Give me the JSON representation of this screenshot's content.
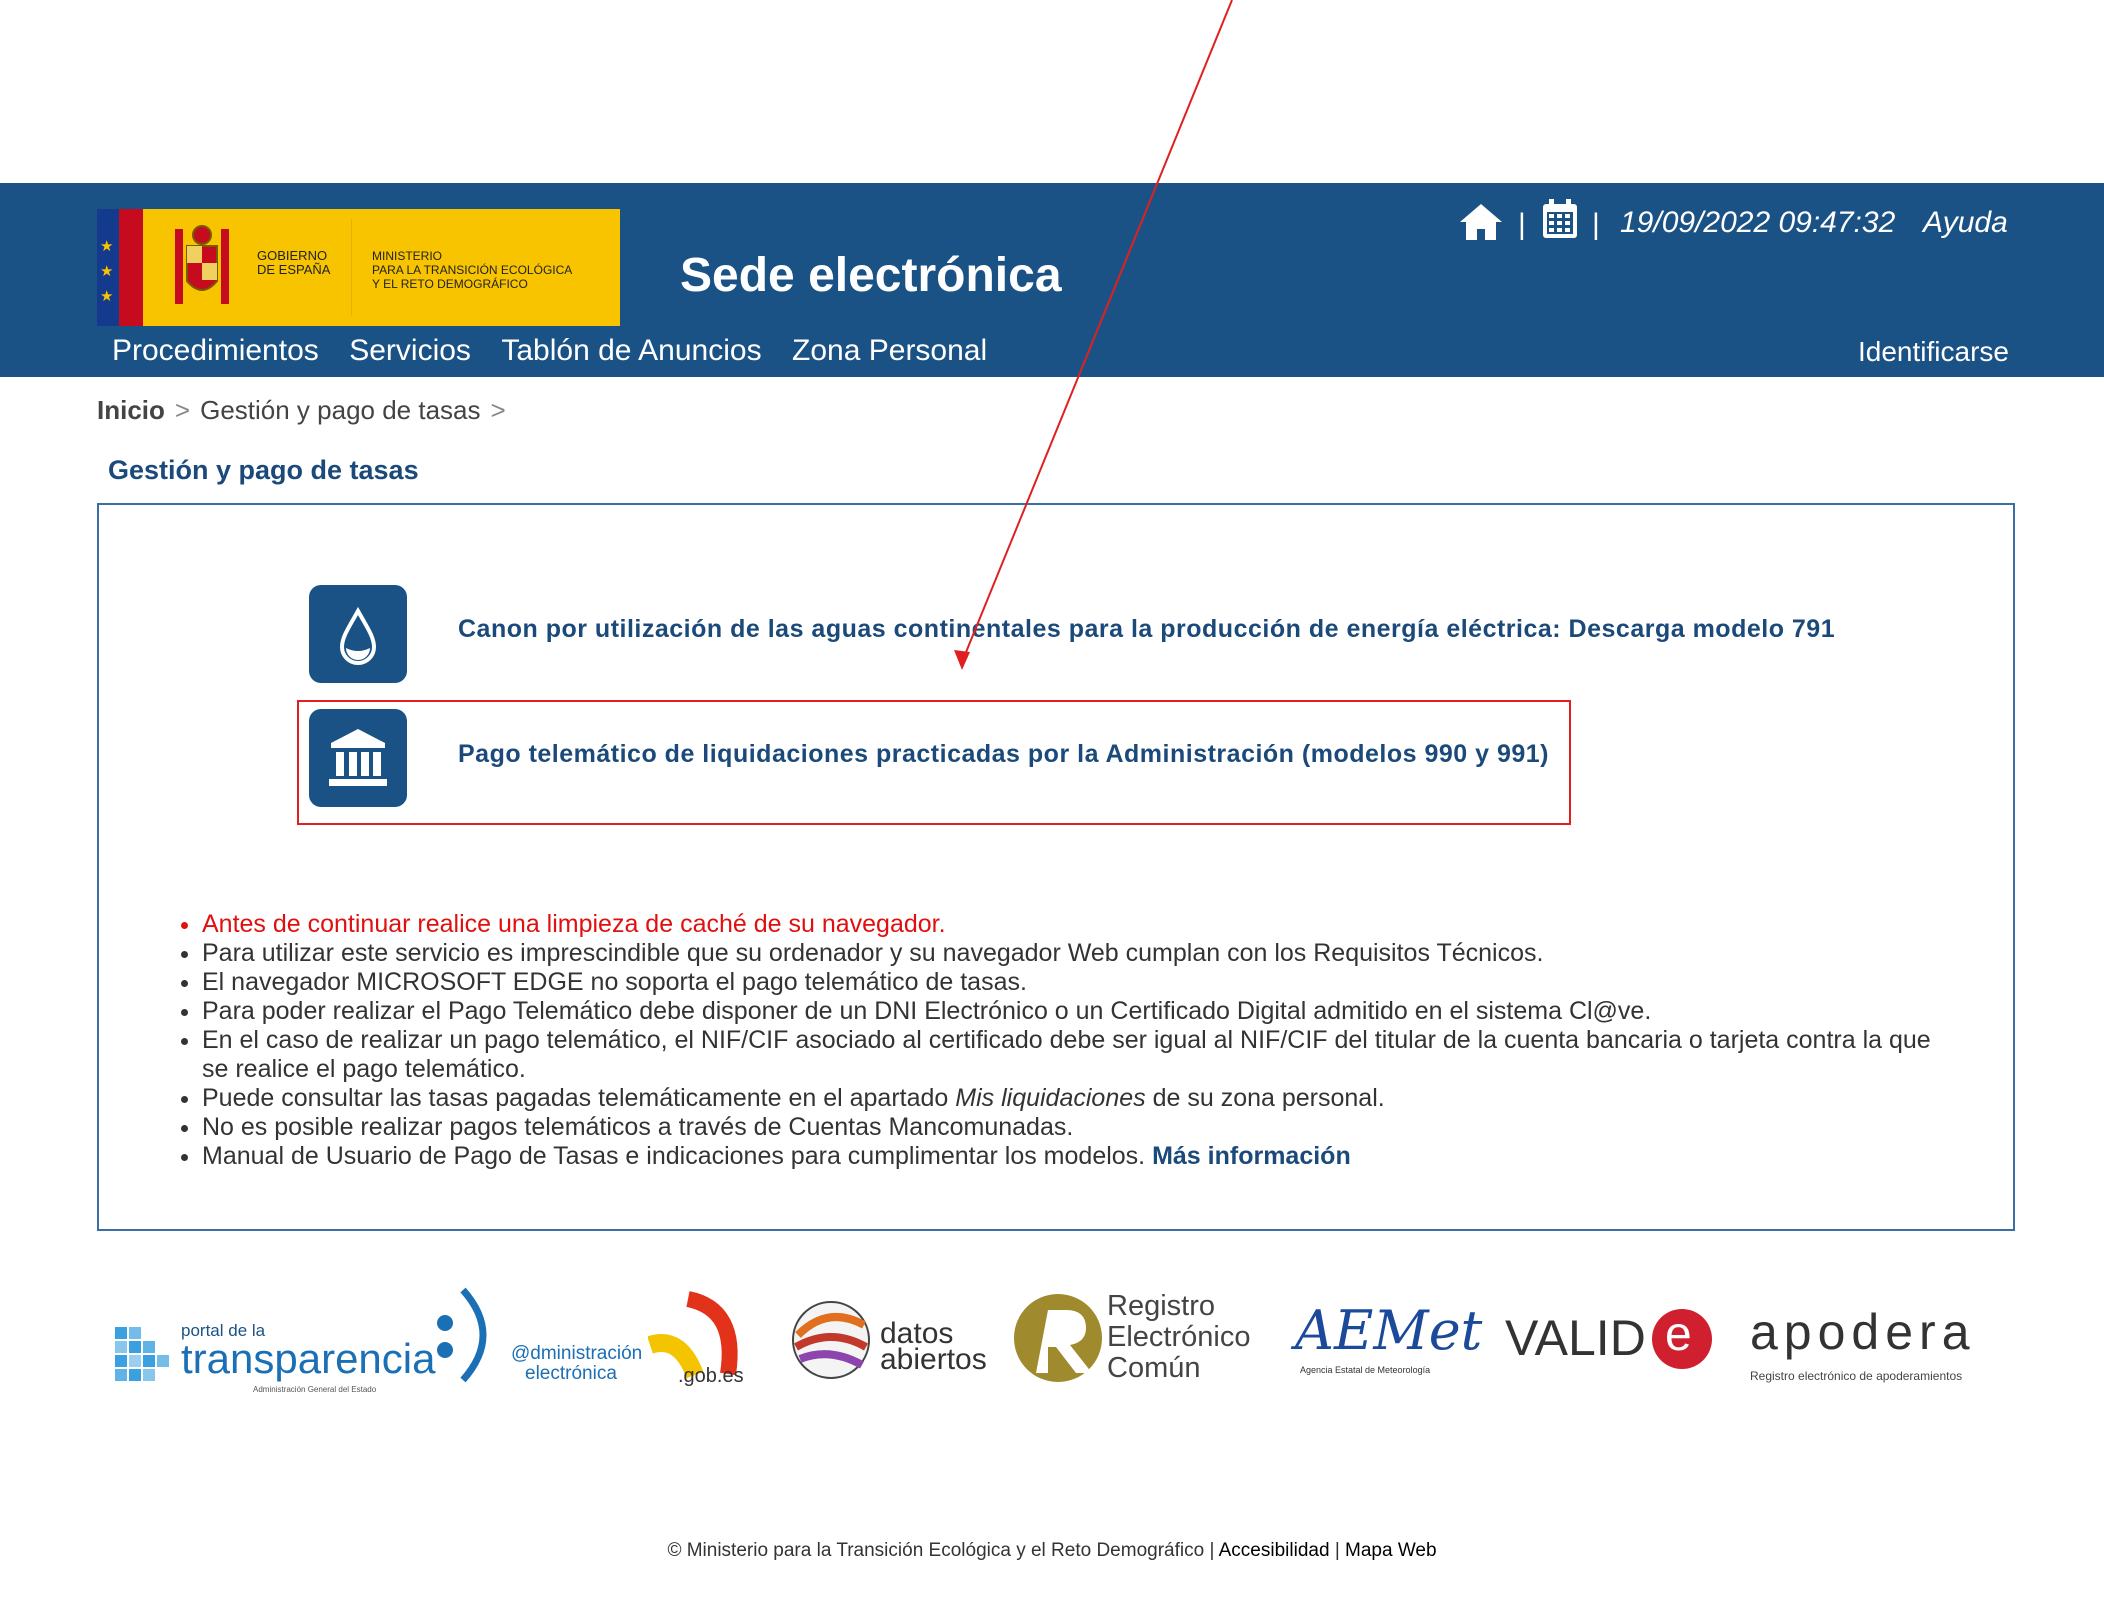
{
  "header": {
    "gov_label_1": "GOBIERNO",
    "gov_label_2": "DE ESPAÑA",
    "ministry_1": "MINISTERIO",
    "ministry_2": "PARA LA TRANSICIÓN ECOLÓGICA",
    "ministry_3": "Y EL RETO DEMOGRÁFICO",
    "site_title": "Sede electrónica",
    "separator": "|",
    "datetime": "19/09/2022 09:47:32",
    "help": "Ayuda",
    "login": "Identificarse"
  },
  "nav": {
    "items": [
      "Procedimientos",
      "Servicios",
      "Tablón de Anuncios",
      "Zona Personal"
    ]
  },
  "breadcrumb": {
    "home": "Inicio",
    "current": "Gestión y pago de tasas",
    "sep": ">"
  },
  "page_title": "Gestión y pago de tasas",
  "services": [
    {
      "label": "Canon por utilización de las aguas continentales para la producción de energía eléctrica: Descarga modelo 791",
      "icon": "water-drop-icon"
    },
    {
      "label": "Pago telemático de liquidaciones practicadas por la Administración (modelos 990 y 991)",
      "icon": "bank-building-icon"
    }
  ],
  "notes": {
    "n1": "Antes de continuar realice una limpieza de caché de su navegador.",
    "n2": "Para utilizar este servicio es imprescindible que su ordenador y su navegador Web cumplan con los Requisitos Técnicos.",
    "n3": "El navegador MICROSOFT EDGE no soporta el pago telemático de tasas.",
    "n4": "Para poder realizar el Pago Telemático debe disponer de un DNI Electrónico o un Certificado Digital admitido en el sistema Cl@ve.",
    "n5": "En el caso de realizar un pago telemático, el NIF/CIF asociado al certificado debe ser igual al NIF/CIF del titular de la cuenta bancaria o tarjeta contra la que se realice el pago telemático.",
    "n6_pre": "Puede consultar las tasas pagadas telemáticamente en el apartado ",
    "n6_em": "Mis liquidaciones",
    "n6_post": " de su zona personal.",
    "n7": "No es posible realizar pagos telemáticos a través de Cuentas Mancomunadas.",
    "n8": "Manual de Usuario de Pago de Tasas e indicaciones para cumplimentar los modelos. ",
    "n8_link": "Más información"
  },
  "partners": {
    "transparencia_small": "portal de la",
    "transparencia": "transparencia",
    "transparencia_sub": "Administración General del Estado",
    "admin_e": "@dministración",
    "admin_e2": "electrónica",
    "gob": ".gob.es",
    "datos_1": "datos",
    "datos_2": "abiertos",
    "rec_1": "Registro",
    "rec_2": "Electrónico",
    "rec_3": "Común",
    "aemet": "AEMet",
    "aemet_sub": "Agencia Estatal de Meteorología",
    "valide": "VALID",
    "valide_e": "e",
    "apodera": "apodera",
    "apodera_sub": "Registro electrónico de apoderamientos"
  },
  "footer": {
    "copyright": "© Ministerio para la Transición Ecológica y el Reto Demográfico",
    "accesibilidad": "Accesibilidad",
    "mapa": "Mapa Web",
    "sep": "|"
  },
  "colors": {
    "header_bg": "#1b5285",
    "link": "#1b4a7a",
    "warning": "#e01010",
    "highlight": "#e02020"
  }
}
